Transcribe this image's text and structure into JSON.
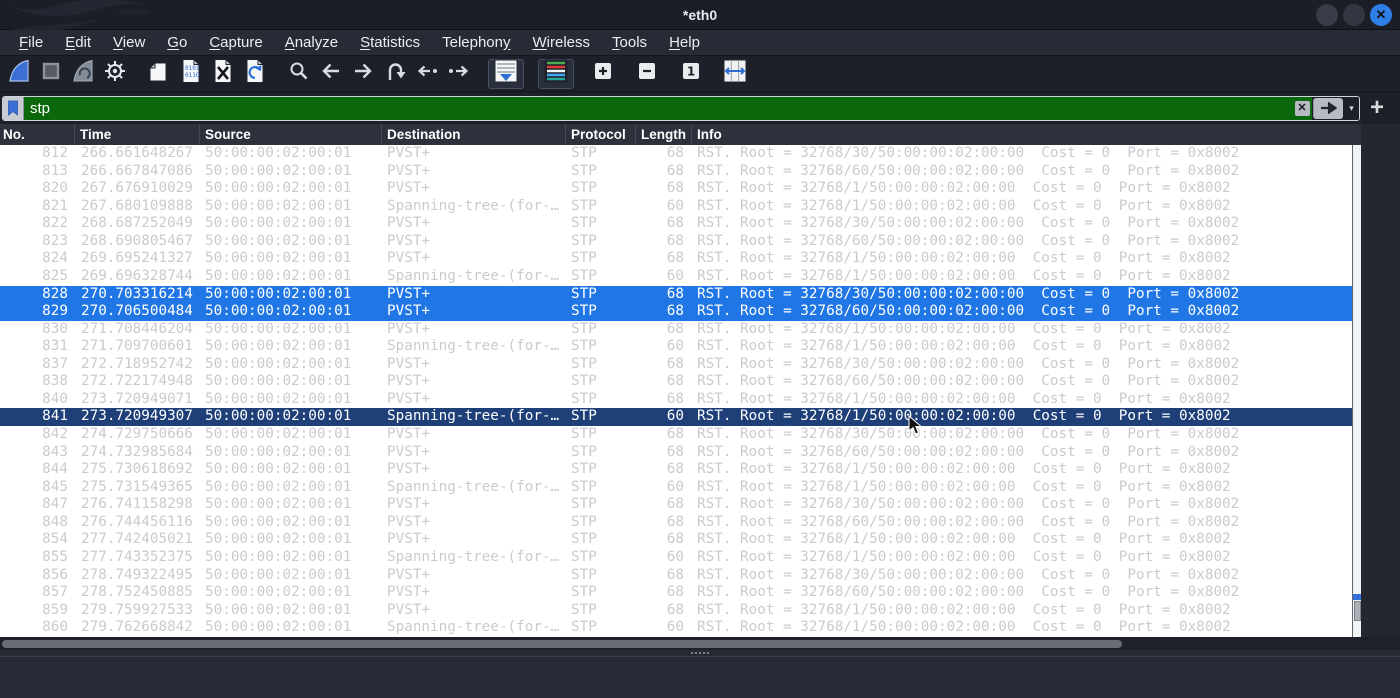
{
  "window": {
    "title": "*eth0"
  },
  "title_bar": {
    "controls": [
      "minimize",
      "maximize",
      "close"
    ],
    "close_glyph": "✕"
  },
  "menu_bar": {
    "items": [
      {
        "label": "File",
        "mnemonic": 0
      },
      {
        "label": "Edit",
        "mnemonic": 0
      },
      {
        "label": "View",
        "mnemonic": 0
      },
      {
        "label": "Go",
        "mnemonic": 0
      },
      {
        "label": "Capture",
        "mnemonic": 0
      },
      {
        "label": "Analyze",
        "mnemonic": 0
      },
      {
        "label": "Statistics",
        "mnemonic": 0
      },
      {
        "label": "Telephony",
        "mnemonic": 8
      },
      {
        "label": "Wireless",
        "mnemonic": 0
      },
      {
        "label": "Tools",
        "mnemonic": 0
      },
      {
        "label": "Help",
        "mnemonic": 0
      }
    ]
  },
  "toolbar": {
    "buttons": [
      {
        "name": "start-capture",
        "icon": "fin-blue",
        "gap": false,
        "active": false
      },
      {
        "name": "stop-capture",
        "icon": "stop-square",
        "gap": false,
        "active": false
      },
      {
        "name": "restart-capture",
        "icon": "fin-gray",
        "gap": false,
        "active": false
      },
      {
        "name": "capture-options",
        "icon": "gear",
        "gap": false,
        "active": false
      },
      {
        "name": "open-file",
        "icon": "doc-plain",
        "gap": true,
        "active": false
      },
      {
        "name": "save-file",
        "icon": "doc-digits",
        "gap": false,
        "active": false
      },
      {
        "name": "close-file",
        "icon": "doc-close",
        "gap": false,
        "active": false
      },
      {
        "name": "reload-file",
        "icon": "doc-reload",
        "gap": false,
        "active": false
      },
      {
        "name": "find-packet",
        "icon": "magnifier",
        "gap": true,
        "active": false
      },
      {
        "name": "go-back",
        "icon": "arrow-left",
        "gap": false,
        "active": false
      },
      {
        "name": "go-forward",
        "icon": "arrow-right",
        "gap": false,
        "active": false
      },
      {
        "name": "go-to-packet",
        "icon": "goto-arc",
        "gap": false,
        "active": false
      },
      {
        "name": "previous-packet",
        "icon": "dot-arrow-left",
        "gap": false,
        "active": false
      },
      {
        "name": "next-packet",
        "icon": "dot-arrow-right",
        "gap": false,
        "active": false
      },
      {
        "name": "auto-scroll",
        "icon": "autoscroll-list",
        "gap": true,
        "active": true
      },
      {
        "name": "colorize-packets",
        "icon": "colorize-list",
        "gap": true,
        "active": true
      },
      {
        "name": "zoom-in",
        "icon": "square-plus",
        "gap": true,
        "active": false
      },
      {
        "name": "zoom-out",
        "icon": "square-minus",
        "gap": true,
        "active": false
      },
      {
        "name": "zoom-normal",
        "icon": "square-one",
        "gap": true,
        "active": false
      },
      {
        "name": "resize-columns",
        "icon": "resize-columns",
        "gap": true,
        "active": false
      }
    ]
  },
  "filter_bar": {
    "value": "stp",
    "caret_glyph": "▾",
    "clear_glyph": "✕",
    "add_button_glyph": "+"
  },
  "colors": {
    "filter_valid_green": "#0c680c",
    "selection_blue": "#1f76e4",
    "selection_navy": "#1e3f78",
    "ignored_row_text": "#c9cbcd",
    "close_button_blue": "#2e7ee6"
  },
  "packet_list": {
    "columns": [
      {
        "label": "No.",
        "key": "no"
      },
      {
        "label": "Time",
        "key": "time"
      },
      {
        "label": "Source",
        "key": "src"
      },
      {
        "label": "Destination",
        "key": "dst"
      },
      {
        "label": "Protocol",
        "key": "proto"
      },
      {
        "label": "Length",
        "key": "len"
      },
      {
        "label": "Info",
        "key": "info"
      }
    ],
    "rows": [
      {
        "no": "812",
        "time": "266.661648267",
        "src": "50:00:00:02:00:01",
        "dst": "PVST+",
        "proto": "STP",
        "len": "68",
        "info": "RST. Root = 32768/30/50:00:00:02:00:00  Cost = 0  Port = 0x8002",
        "state": "normal"
      },
      {
        "no": "813",
        "time": "266.667847086",
        "src": "50:00:00:02:00:01",
        "dst": "PVST+",
        "proto": "STP",
        "len": "68",
        "info": "RST. Root = 32768/60/50:00:00:02:00:00  Cost = 0  Port = 0x8002",
        "state": "normal"
      },
      {
        "no": "820",
        "time": "267.676910029",
        "src": "50:00:00:02:00:01",
        "dst": "PVST+",
        "proto": "STP",
        "len": "68",
        "info": "RST. Root = 32768/1/50:00:00:02:00:00  Cost = 0  Port = 0x8002",
        "state": "normal"
      },
      {
        "no": "821",
        "time": "267.680109888",
        "src": "50:00:00:02:00:01",
        "dst": "Spanning-tree-(for-…",
        "proto": "STP",
        "len": "60",
        "info": "RST. Root = 32768/1/50:00:00:02:00:00  Cost = 0  Port = 0x8002",
        "state": "normal"
      },
      {
        "no": "822",
        "time": "268.687252049",
        "src": "50:00:00:02:00:01",
        "dst": "PVST+",
        "proto": "STP",
        "len": "68",
        "info": "RST. Root = 32768/30/50:00:00:02:00:00  Cost = 0  Port = 0x8002",
        "state": "normal"
      },
      {
        "no": "823",
        "time": "268.690805467",
        "src": "50:00:00:02:00:01",
        "dst": "PVST+",
        "proto": "STP",
        "len": "68",
        "info": "RST. Root = 32768/60/50:00:00:02:00:00  Cost = 0  Port = 0x8002",
        "state": "normal"
      },
      {
        "no": "824",
        "time": "269.695241327",
        "src": "50:00:00:02:00:01",
        "dst": "PVST+",
        "proto": "STP",
        "len": "68",
        "info": "RST. Root = 32768/1/50:00:00:02:00:00  Cost = 0  Port = 0x8002",
        "state": "normal"
      },
      {
        "no": "825",
        "time": "269.696328744",
        "src": "50:00:00:02:00:01",
        "dst": "Spanning-tree-(for-…",
        "proto": "STP",
        "len": "60",
        "info": "RST. Root = 32768/1/50:00:00:02:00:00  Cost = 0  Port = 0x8002",
        "state": "normal"
      },
      {
        "no": "828",
        "time": "270.703316214",
        "src": "50:00:00:02:00:01",
        "dst": "PVST+",
        "proto": "STP",
        "len": "68",
        "info": "RST. Root = 32768/30/50:00:00:02:00:00  Cost = 0  Port = 0x8002",
        "state": "selected"
      },
      {
        "no": "829",
        "time": "270.706500484",
        "src": "50:00:00:02:00:01",
        "dst": "PVST+",
        "proto": "STP",
        "len": "68",
        "info": "RST. Root = 32768/60/50:00:00:02:00:00  Cost = 0  Port = 0x8002",
        "state": "selected"
      },
      {
        "no": "830",
        "time": "271.708446204",
        "src": "50:00:00:02:00:01",
        "dst": "PVST+",
        "proto": "STP",
        "len": "68",
        "info": "RST. Root = 32768/1/50:00:00:02:00:00  Cost = 0  Port = 0x8002",
        "state": "normal"
      },
      {
        "no": "831",
        "time": "271.709700601",
        "src": "50:00:00:02:00:01",
        "dst": "Spanning-tree-(for-…",
        "proto": "STP",
        "len": "60",
        "info": "RST. Root = 32768/1/50:00:00:02:00:00  Cost = 0  Port = 0x8002",
        "state": "normal"
      },
      {
        "no": "837",
        "time": "272.718952742",
        "src": "50:00:00:02:00:01",
        "dst": "PVST+",
        "proto": "STP",
        "len": "68",
        "info": "RST. Root = 32768/30/50:00:00:02:00:00  Cost = 0  Port = 0x8002",
        "state": "normal"
      },
      {
        "no": "838",
        "time": "272.722174948",
        "src": "50:00:00:02:00:01",
        "dst": "PVST+",
        "proto": "STP",
        "len": "68",
        "info": "RST. Root = 32768/60/50:00:00:02:00:00  Cost = 0  Port = 0x8002",
        "state": "normal"
      },
      {
        "no": "840",
        "time": "273.720949071",
        "src": "50:00:00:02:00:01",
        "dst": "PVST+",
        "proto": "STP",
        "len": "68",
        "info": "RST. Root = 32768/1/50:00:00:02:00:00  Cost = 0  Port = 0x8002",
        "state": "normal"
      },
      {
        "no": "841",
        "time": "273.720949307",
        "src": "50:00:00:02:00:01",
        "dst": "Spanning-tree-(for-…",
        "proto": "STP",
        "len": "60",
        "info": "RST. Root = 32768/1/50:00:00:02:00:00  Cost = 0  Port = 0x8002",
        "state": "selected-secondary"
      },
      {
        "no": "842",
        "time": "274.729750666",
        "src": "50:00:00:02:00:01",
        "dst": "PVST+",
        "proto": "STP",
        "len": "68",
        "info": "RST. Root = 32768/30/50:00:00:02:00:00  Cost = 0  Port = 0x8002",
        "state": "normal"
      },
      {
        "no": "843",
        "time": "274.732985684",
        "src": "50:00:00:02:00:01",
        "dst": "PVST+",
        "proto": "STP",
        "len": "68",
        "info": "RST. Root = 32768/60/50:00:00:02:00:00  Cost = 0  Port = 0x8002",
        "state": "normal"
      },
      {
        "no": "844",
        "time": "275.730618692",
        "src": "50:00:00:02:00:01",
        "dst": "PVST+",
        "proto": "STP",
        "len": "68",
        "info": "RST. Root = 32768/1/50:00:00:02:00:00  Cost = 0  Port = 0x8002",
        "state": "normal"
      },
      {
        "no": "845",
        "time": "275.731549365",
        "src": "50:00:00:02:00:01",
        "dst": "Spanning-tree-(for-…",
        "proto": "STP",
        "len": "60",
        "info": "RST. Root = 32768/1/50:00:00:02:00:00  Cost = 0  Port = 0x8002",
        "state": "normal"
      },
      {
        "no": "847",
        "time": "276.741158298",
        "src": "50:00:00:02:00:01",
        "dst": "PVST+",
        "proto": "STP",
        "len": "68",
        "info": "RST. Root = 32768/30/50:00:00:02:00:00  Cost = 0  Port = 0x8002",
        "state": "normal"
      },
      {
        "no": "848",
        "time": "276.744456116",
        "src": "50:00:00:02:00:01",
        "dst": "PVST+",
        "proto": "STP",
        "len": "68",
        "info": "RST. Root = 32768/60/50:00:00:02:00:00  Cost = 0  Port = 0x8002",
        "state": "normal"
      },
      {
        "no": "854",
        "time": "277.742405021",
        "src": "50:00:00:02:00:01",
        "dst": "PVST+",
        "proto": "STP",
        "len": "68",
        "info": "RST. Root = 32768/1/50:00:00:02:00:00  Cost = 0  Port = 0x8002",
        "state": "normal"
      },
      {
        "no": "855",
        "time": "277.743352375",
        "src": "50:00:00:02:00:01",
        "dst": "Spanning-tree-(for-…",
        "proto": "STP",
        "len": "60",
        "info": "RST. Root = 32768/1/50:00:00:02:00:00  Cost = 0  Port = 0x8002",
        "state": "normal"
      },
      {
        "no": "856",
        "time": "278.749322495",
        "src": "50:00:00:02:00:01",
        "dst": "PVST+",
        "proto": "STP",
        "len": "68",
        "info": "RST. Root = 32768/30/50:00:00:02:00:00  Cost = 0  Port = 0x8002",
        "state": "normal"
      },
      {
        "no": "857",
        "time": "278.752450885",
        "src": "50:00:00:02:00:01",
        "dst": "PVST+",
        "proto": "STP",
        "len": "68",
        "info": "RST. Root = 32768/60/50:00:00:02:00:00  Cost = 0  Port = 0x8002",
        "state": "normal"
      },
      {
        "no": "859",
        "time": "279.759927533",
        "src": "50:00:00:02:00:01",
        "dst": "PVST+",
        "proto": "STP",
        "len": "68",
        "info": "RST. Root = 32768/1/50:00:00:02:00:00  Cost = 0  Port = 0x8002",
        "state": "normal"
      },
      {
        "no": "860",
        "time": "279.762668842",
        "src": "50:00:00:02:00:01",
        "dst": "Spanning-tree-(for-…",
        "proto": "STP",
        "len": "60",
        "info": "RST. Root = 32768/1/50:00:00:02:00:00  Cost = 0  Port = 0x8002",
        "state": "normal"
      }
    ]
  }
}
